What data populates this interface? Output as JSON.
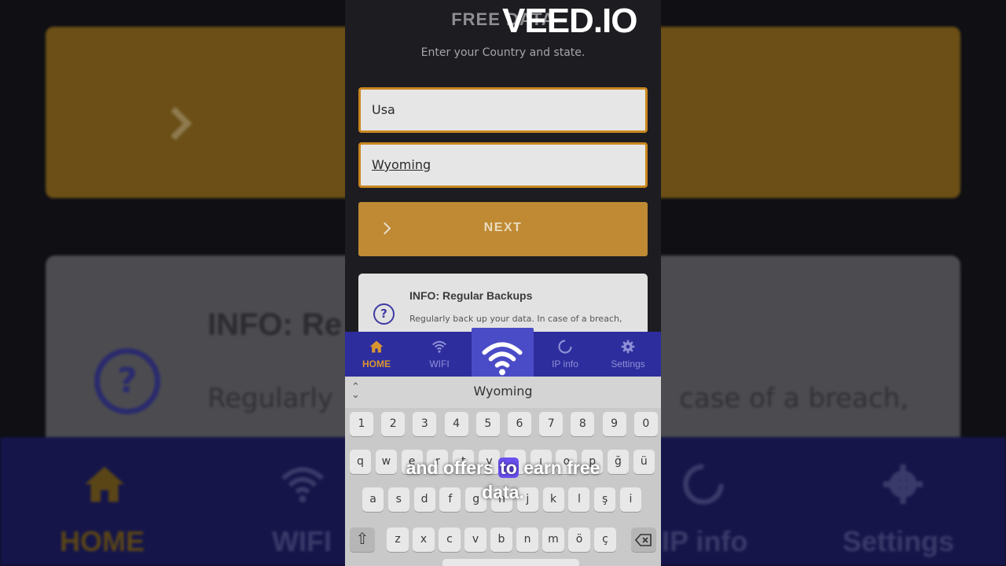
{
  "watermark": "VEED.IO",
  "app": {
    "title": "FREE DATA",
    "subtitle": "Enter your Country and state.",
    "country_value": "Usa",
    "state_value": "Wyoming",
    "next_label": "NEXT",
    "info_title": "INFO: Regular Backups",
    "info_text": "Regularly back up your data. In case of a breach,",
    "info_icon": "?"
  },
  "nav": {
    "items": [
      {
        "label": "HOME",
        "icon": "home-icon",
        "active": true
      },
      {
        "label": "WIFI",
        "icon": "wifi-icon"
      },
      {
        "label": "",
        "icon": "wifi-icon"
      },
      {
        "label": "IP info",
        "icon": "refresh-icon"
      },
      {
        "label": "Settings",
        "icon": "gear-icon"
      }
    ],
    "active_color": "#d99530",
    "bar_color": "#2d2d9e"
  },
  "keyboard": {
    "suggestion": "Wyoming",
    "rows": [
      [
        "1",
        "2",
        "3",
        "4",
        "5",
        "6",
        "7",
        "8",
        "9",
        "0"
      ],
      [
        "q",
        "w",
        "e",
        "r",
        "t",
        "y",
        "u",
        "ı",
        "o",
        "p",
        "ğ",
        "ü"
      ],
      [
        "a",
        "s",
        "d",
        "f",
        "g",
        "h",
        "j",
        "k",
        "l",
        "ş",
        "i"
      ],
      [
        "z",
        "x",
        "c",
        "v",
        "b",
        "n",
        "m",
        "ö",
        "ç"
      ]
    ]
  },
  "caption": {
    "line1_before": "and offers",
    "line1_highlight": "to",
    "line1_after": "earn free",
    "line2": "data."
  },
  "background": {
    "info_title": "INFO: Re",
    "info_icon": "?",
    "info_text_left": "Regularly",
    "info_text_right": "case of a breach,",
    "nav_labels": [
      "HOME",
      "WIFI",
      "IP info",
      "Settings"
    ]
  },
  "colors": {
    "accent_orange": "#c8861f",
    "nav_blue": "#2d2d9e",
    "highlight_purple": "#6a4ff0"
  }
}
